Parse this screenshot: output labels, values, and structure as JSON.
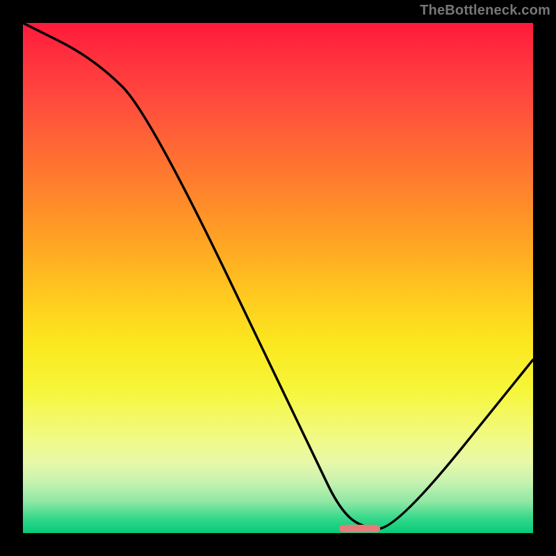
{
  "watermark": "TheBottleneck.com",
  "colors": {
    "background": "#000000",
    "gradient_top": "#ff1a3a",
    "gradient_bottom": "#06ca78",
    "curve": "#000000",
    "marker": "#e77b7a"
  },
  "chart_data": {
    "type": "line",
    "title": "",
    "xlabel": "",
    "ylabel": "",
    "xlim": [
      0,
      100
    ],
    "ylim": [
      0,
      100
    ],
    "grid": false,
    "legend": false,
    "series": [
      {
        "name": "curve",
        "x": [
          0,
          14,
          25,
          58,
          62,
          66,
          73,
          100
        ],
        "values": [
          100,
          93,
          82,
          13,
          5,
          1.2,
          0.5,
          34
        ]
      }
    ],
    "marker": {
      "x_start": 62,
      "x_end": 70,
      "y": 0.9
    }
  }
}
